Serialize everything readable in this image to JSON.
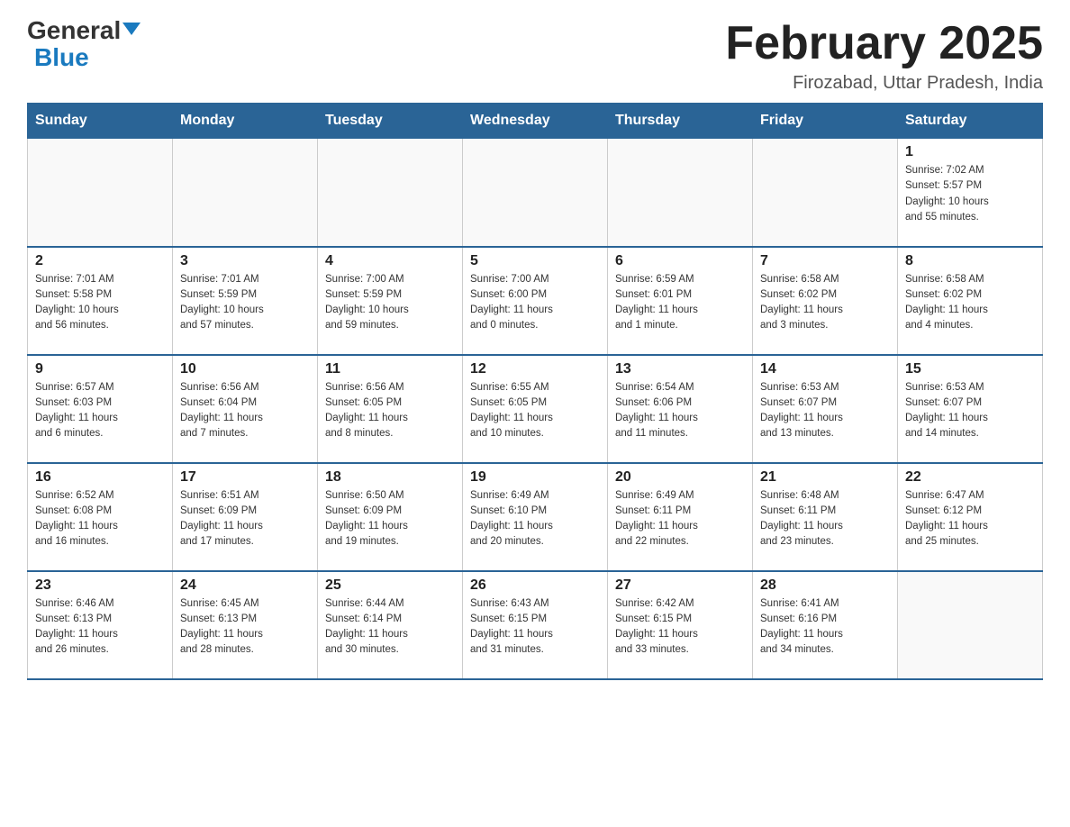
{
  "header": {
    "logo_general": "General",
    "logo_blue": "Blue",
    "title": "February 2025",
    "subtitle": "Firozabad, Uttar Pradesh, India"
  },
  "days_of_week": [
    "Sunday",
    "Monday",
    "Tuesday",
    "Wednesday",
    "Thursday",
    "Friday",
    "Saturday"
  ],
  "weeks": [
    [
      {
        "day": "",
        "info": ""
      },
      {
        "day": "",
        "info": ""
      },
      {
        "day": "",
        "info": ""
      },
      {
        "day": "",
        "info": ""
      },
      {
        "day": "",
        "info": ""
      },
      {
        "day": "",
        "info": ""
      },
      {
        "day": "1",
        "info": "Sunrise: 7:02 AM\nSunset: 5:57 PM\nDaylight: 10 hours\nand 55 minutes."
      }
    ],
    [
      {
        "day": "2",
        "info": "Sunrise: 7:01 AM\nSunset: 5:58 PM\nDaylight: 10 hours\nand 56 minutes."
      },
      {
        "day": "3",
        "info": "Sunrise: 7:01 AM\nSunset: 5:59 PM\nDaylight: 10 hours\nand 57 minutes."
      },
      {
        "day": "4",
        "info": "Sunrise: 7:00 AM\nSunset: 5:59 PM\nDaylight: 10 hours\nand 59 minutes."
      },
      {
        "day": "5",
        "info": "Sunrise: 7:00 AM\nSunset: 6:00 PM\nDaylight: 11 hours\nand 0 minutes."
      },
      {
        "day": "6",
        "info": "Sunrise: 6:59 AM\nSunset: 6:01 PM\nDaylight: 11 hours\nand 1 minute."
      },
      {
        "day": "7",
        "info": "Sunrise: 6:58 AM\nSunset: 6:02 PM\nDaylight: 11 hours\nand 3 minutes."
      },
      {
        "day": "8",
        "info": "Sunrise: 6:58 AM\nSunset: 6:02 PM\nDaylight: 11 hours\nand 4 minutes."
      }
    ],
    [
      {
        "day": "9",
        "info": "Sunrise: 6:57 AM\nSunset: 6:03 PM\nDaylight: 11 hours\nand 6 minutes."
      },
      {
        "day": "10",
        "info": "Sunrise: 6:56 AM\nSunset: 6:04 PM\nDaylight: 11 hours\nand 7 minutes."
      },
      {
        "day": "11",
        "info": "Sunrise: 6:56 AM\nSunset: 6:05 PM\nDaylight: 11 hours\nand 8 minutes."
      },
      {
        "day": "12",
        "info": "Sunrise: 6:55 AM\nSunset: 6:05 PM\nDaylight: 11 hours\nand 10 minutes."
      },
      {
        "day": "13",
        "info": "Sunrise: 6:54 AM\nSunset: 6:06 PM\nDaylight: 11 hours\nand 11 minutes."
      },
      {
        "day": "14",
        "info": "Sunrise: 6:53 AM\nSunset: 6:07 PM\nDaylight: 11 hours\nand 13 minutes."
      },
      {
        "day": "15",
        "info": "Sunrise: 6:53 AM\nSunset: 6:07 PM\nDaylight: 11 hours\nand 14 minutes."
      }
    ],
    [
      {
        "day": "16",
        "info": "Sunrise: 6:52 AM\nSunset: 6:08 PM\nDaylight: 11 hours\nand 16 minutes."
      },
      {
        "day": "17",
        "info": "Sunrise: 6:51 AM\nSunset: 6:09 PM\nDaylight: 11 hours\nand 17 minutes."
      },
      {
        "day": "18",
        "info": "Sunrise: 6:50 AM\nSunset: 6:09 PM\nDaylight: 11 hours\nand 19 minutes."
      },
      {
        "day": "19",
        "info": "Sunrise: 6:49 AM\nSunset: 6:10 PM\nDaylight: 11 hours\nand 20 minutes."
      },
      {
        "day": "20",
        "info": "Sunrise: 6:49 AM\nSunset: 6:11 PM\nDaylight: 11 hours\nand 22 minutes."
      },
      {
        "day": "21",
        "info": "Sunrise: 6:48 AM\nSunset: 6:11 PM\nDaylight: 11 hours\nand 23 minutes."
      },
      {
        "day": "22",
        "info": "Sunrise: 6:47 AM\nSunset: 6:12 PM\nDaylight: 11 hours\nand 25 minutes."
      }
    ],
    [
      {
        "day": "23",
        "info": "Sunrise: 6:46 AM\nSunset: 6:13 PM\nDaylight: 11 hours\nand 26 minutes."
      },
      {
        "day": "24",
        "info": "Sunrise: 6:45 AM\nSunset: 6:13 PM\nDaylight: 11 hours\nand 28 minutes."
      },
      {
        "day": "25",
        "info": "Sunrise: 6:44 AM\nSunset: 6:14 PM\nDaylight: 11 hours\nand 30 minutes."
      },
      {
        "day": "26",
        "info": "Sunrise: 6:43 AM\nSunset: 6:15 PM\nDaylight: 11 hours\nand 31 minutes."
      },
      {
        "day": "27",
        "info": "Sunrise: 6:42 AM\nSunset: 6:15 PM\nDaylight: 11 hours\nand 33 minutes."
      },
      {
        "day": "28",
        "info": "Sunrise: 6:41 AM\nSunset: 6:16 PM\nDaylight: 11 hours\nand 34 minutes."
      },
      {
        "day": "",
        "info": ""
      }
    ]
  ]
}
